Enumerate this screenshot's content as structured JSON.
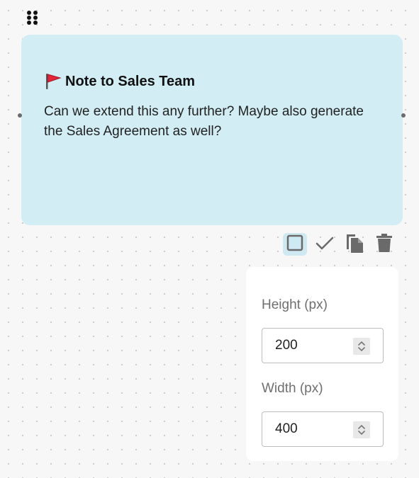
{
  "note": {
    "title": "Note to Sales Team",
    "body": "Can we extend this any further? Maybe also generate the Sales Agreement as well?",
    "background_color": "#d2eef4",
    "title_icon": "red-flag-icon"
  },
  "toolbar": {
    "buttons": [
      {
        "name": "select-box-icon",
        "active": true
      },
      {
        "name": "checkmark-icon",
        "active": false
      },
      {
        "name": "duplicate-icon",
        "active": false
      },
      {
        "name": "trash-icon",
        "active": false
      }
    ],
    "active_color": "#cfe9f2"
  },
  "size_panel": {
    "height_label": "Height (px)",
    "height_value": "200",
    "width_label": "Width (px)",
    "width_value": "400"
  },
  "canvas": {
    "background_color": "#f7f7f7",
    "dot_color": "#c9c9c9"
  }
}
